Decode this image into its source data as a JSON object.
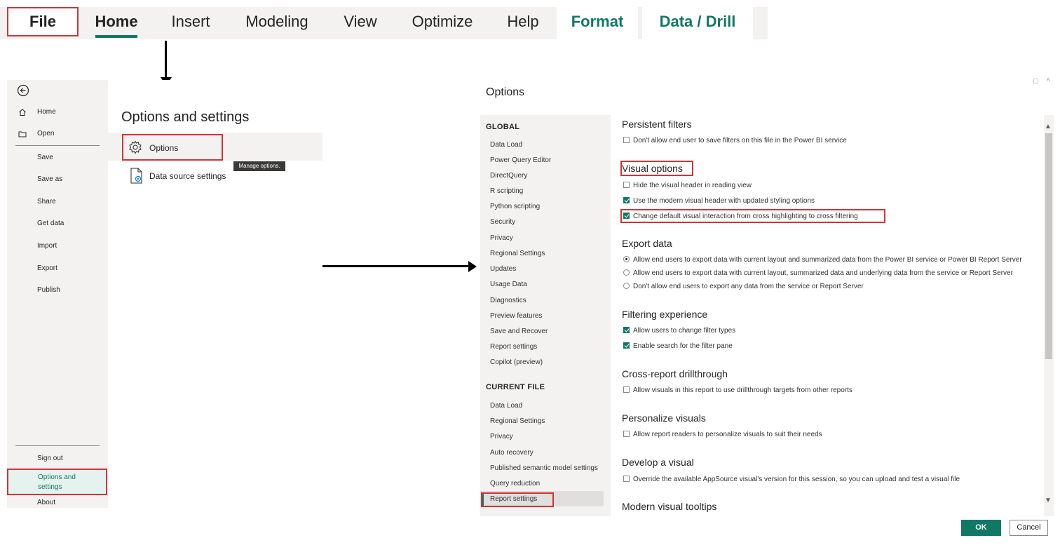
{
  "ribbon": {
    "tabs": [
      {
        "label": "File"
      },
      {
        "label": "Home"
      },
      {
        "label": "Insert"
      },
      {
        "label": "Modeling"
      },
      {
        "label": "View"
      },
      {
        "label": "Optimize"
      },
      {
        "label": "Help"
      },
      {
        "label": "Format"
      },
      {
        "label": "Data / Drill"
      }
    ],
    "accent_color": "#117865",
    "highlight_color": "#d13438"
  },
  "backstage": {
    "nav": [
      {
        "label": "Home",
        "icon": "home-icon"
      },
      {
        "label": "Open",
        "icon": "folder-icon"
      },
      {
        "label": "Save"
      },
      {
        "label": "Save as"
      },
      {
        "label": "Share"
      },
      {
        "label": "Get data"
      },
      {
        "label": "Import"
      },
      {
        "label": "Export"
      },
      {
        "label": "Publish"
      }
    ],
    "bottom_nav": [
      {
        "label": "Sign out"
      },
      {
        "label": "Options and settings"
      },
      {
        "label": "About"
      }
    ],
    "main": {
      "title": "Options and settings",
      "options_label": "Options",
      "data_source_label": "Data source settings",
      "tooltip": "Manage options."
    }
  },
  "dialog": {
    "title": "Options",
    "global_heading": "GLOBAL",
    "global_items": [
      "Data Load",
      "Power Query Editor",
      "DirectQuery",
      "R scripting",
      "Python scripting",
      "Security",
      "Privacy",
      "Regional Settings",
      "Updates",
      "Usage Data",
      "Diagnostics",
      "Preview features",
      "Save and Recover",
      "Report settings",
      "Copilot (preview)"
    ],
    "current_heading": "CURRENT FILE",
    "current_items": [
      "Data Load",
      "Regional Settings",
      "Privacy",
      "Auto recovery",
      "Published semantic model settings",
      "Query reduction",
      "Report settings"
    ],
    "sections": {
      "persistent": {
        "heading": "Persistent filters",
        "opt1": "Don't allow end user to save filters on this file in the Power BI service"
      },
      "visual": {
        "heading": "Visual options",
        "opt1": "Hide the visual header in reading view",
        "opt2": "Use the modern visual header with updated styling options",
        "opt3": "Change default visual interaction from cross highlighting to cross filtering"
      },
      "export": {
        "heading": "Export data",
        "opt1": "Allow end users to export data with current layout and summarized data from the Power BI service or Power BI Report Server",
        "opt2": "Allow end users to export data with current layout, summarized data and underlying data from the service or Report Server",
        "opt3": "Don't allow end users to export any data from the service or Report Server"
      },
      "filtering": {
        "heading": "Filtering experience",
        "opt1": "Allow users to change filter types",
        "opt2": "Enable search for the filter pane"
      },
      "drill": {
        "heading": "Cross-report drillthrough",
        "opt1": "Allow visuals in this report to use drillthrough targets from other reports"
      },
      "personalize": {
        "heading": "Personalize visuals",
        "opt1": "Allow report readers to personalize visuals to suit their needs"
      },
      "develop": {
        "heading": "Develop a visual",
        "opt1": "Override the available AppSource visual's version for this session, so you can upload and test a visual file"
      },
      "tooltips": {
        "heading": "Modern visual tooltips"
      }
    },
    "buttons": {
      "ok": "OK",
      "cancel": "Cancel"
    }
  }
}
